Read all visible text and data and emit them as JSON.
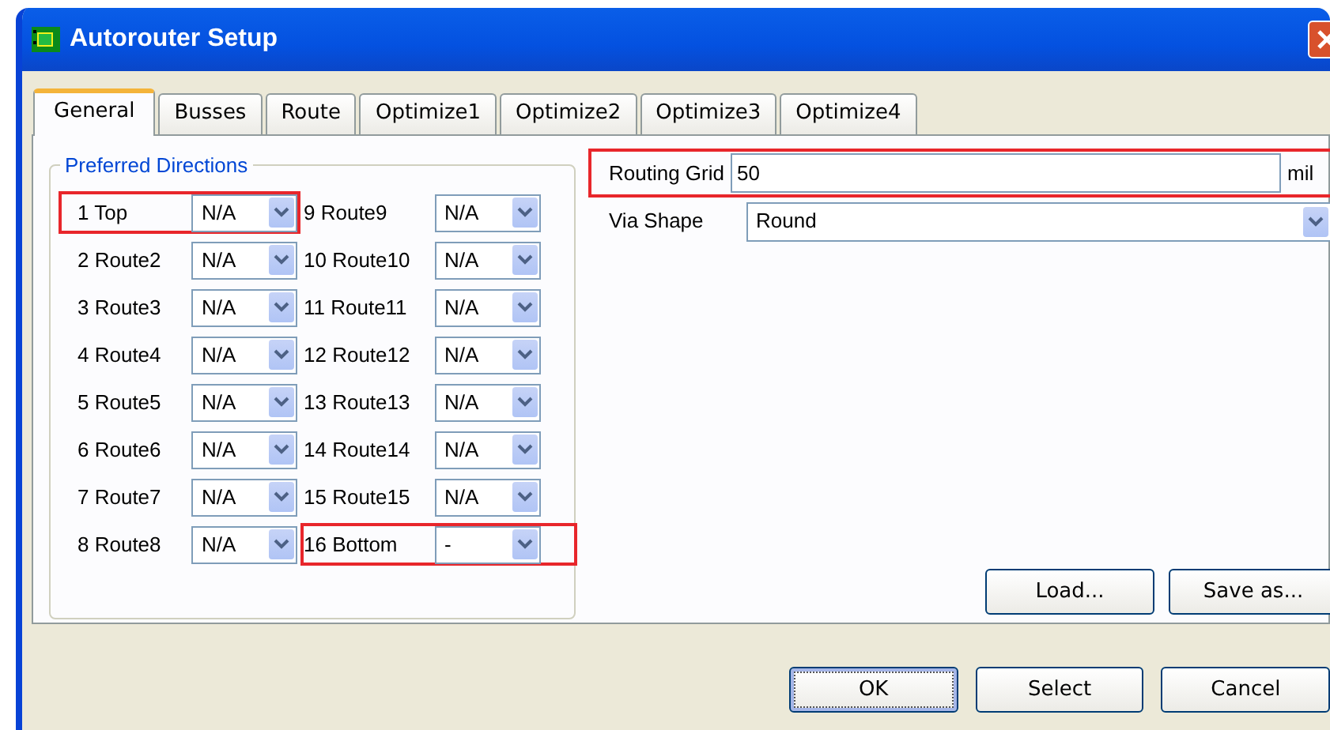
{
  "window": {
    "title": "Autorouter Setup"
  },
  "tabs": [
    {
      "label": "General",
      "selected": true
    },
    {
      "label": "Busses",
      "selected": false
    },
    {
      "label": "Route",
      "selected": false
    },
    {
      "label": "Optimize1",
      "selected": false
    },
    {
      "label": "Optimize2",
      "selected": false
    },
    {
      "label": "Optimize3",
      "selected": false
    },
    {
      "label": "Optimize4",
      "selected": false
    }
  ],
  "preferred_directions": {
    "title": "Preferred Directions",
    "layers": [
      {
        "label": "1 Top",
        "value": "N/A",
        "highlighted": true
      },
      {
        "label": "2 Route2",
        "value": "N/A",
        "highlighted": false
      },
      {
        "label": "3 Route3",
        "value": "N/A",
        "highlighted": false
      },
      {
        "label": "4 Route4",
        "value": "N/A",
        "highlighted": false
      },
      {
        "label": "5 Route5",
        "value": "N/A",
        "highlighted": false
      },
      {
        "label": "6 Route6",
        "value": "N/A",
        "highlighted": false
      },
      {
        "label": "7 Route7",
        "value": "N/A",
        "highlighted": false
      },
      {
        "label": "8 Route8",
        "value": "N/A",
        "highlighted": false
      },
      {
        "label": "9 Route9",
        "value": "N/A",
        "highlighted": false
      },
      {
        "label": "10 Route10",
        "value": "N/A",
        "highlighted": false
      },
      {
        "label": "11 Route11",
        "value": "N/A",
        "highlighted": false
      },
      {
        "label": "12 Route12",
        "value": "N/A",
        "highlighted": false
      },
      {
        "label": "13 Route13",
        "value": "N/A",
        "highlighted": false
      },
      {
        "label": "14 Route14",
        "value": "N/A",
        "highlighted": false
      },
      {
        "label": "15 Route15",
        "value": "N/A",
        "highlighted": false
      },
      {
        "label": "16 Bottom",
        "value": "-",
        "highlighted": true
      }
    ]
  },
  "routing_grid": {
    "label": "Routing Grid",
    "value": "50",
    "unit": "mil",
    "highlighted": true
  },
  "via_shape": {
    "label": "Via Shape",
    "value": "Round"
  },
  "panel_buttons": [
    "Load...",
    "Save as..."
  ],
  "buttons": [
    {
      "label": "OK",
      "default": true
    },
    {
      "label": "Select",
      "default": false
    },
    {
      "label": "Cancel",
      "default": false
    }
  ]
}
